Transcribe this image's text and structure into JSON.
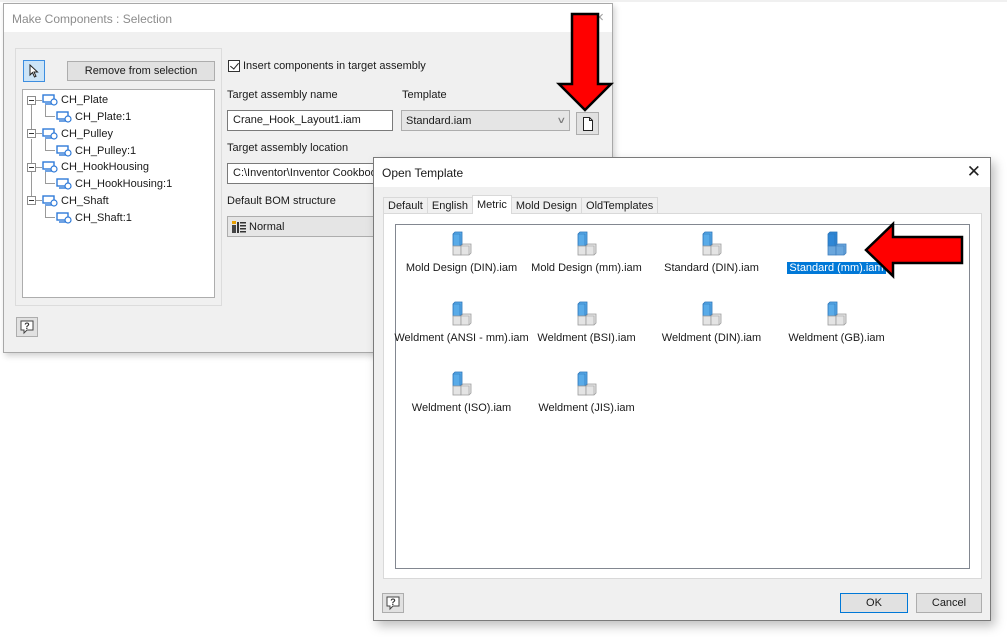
{
  "make_components": {
    "title": "Make Components : Selection",
    "close_label": "×",
    "remove_button": "Remove from selection",
    "tree": [
      {
        "label": "CH_Plate",
        "child": "CH_Plate:1"
      },
      {
        "label": "CH_Pulley",
        "child": "CH_Pulley:1"
      },
      {
        "label": "CH_HookHousing",
        "child": "CH_HookHousing:1"
      },
      {
        "label": "CH_Shaft",
        "child": "CH_Shaft:1"
      }
    ],
    "insert_checkbox": {
      "label": "Insert components in target assembly",
      "checked": true
    },
    "target_name_label": "Target assembly name",
    "target_name_value": "Crane_Hook_Layout1.iam",
    "template_label": "Template",
    "template_value": "Standard.iam",
    "location_label": "Target assembly location",
    "location_value": "C:\\Inventor\\Inventor Cookbook",
    "bom_label": "Default BOM structure",
    "bom_value": "Normal"
  },
  "open_template": {
    "title": "Open Template",
    "close_label": "✕",
    "tabs": [
      "Default",
      "English",
      "Metric",
      "Mold Design",
      "OldTemplates"
    ],
    "active_tab": "Metric",
    "files": [
      {
        "name": "Mold Design (DIN).iam",
        "selected": false
      },
      {
        "name": "Mold Design (mm).iam",
        "selected": false
      },
      {
        "name": "Standard (DIN).iam",
        "selected": false
      },
      {
        "name": "Standard (mm).iam",
        "selected": true
      },
      {
        "name": "Weldment (ANSI - mm).iam",
        "selected": false
      },
      {
        "name": "Weldment (BSI).iam",
        "selected": false
      },
      {
        "name": "Weldment (DIN).iam",
        "selected": false
      },
      {
        "name": "Weldment (GB).iam",
        "selected": false
      },
      {
        "name": "Weldment (ISO).iam",
        "selected": false
      },
      {
        "name": "Weldment (JIS).iam",
        "selected": false
      }
    ],
    "ok_button": "OK",
    "cancel_button": "Cancel"
  },
  "colors": {
    "annotation_arrow": "#ff0000",
    "selection_highlight": "#0078d7",
    "icon_blue": "#4da3e6"
  }
}
